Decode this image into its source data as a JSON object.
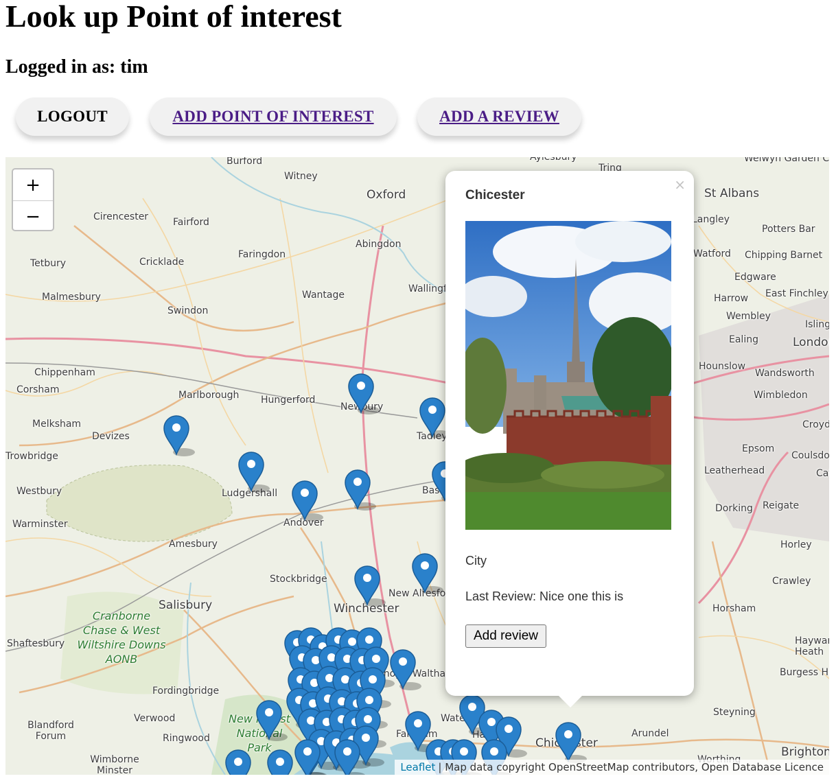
{
  "page": {
    "title": "Look up Point of interest",
    "logged_in": "Logged in as: tim"
  },
  "nav": {
    "logout": "LOGOUT",
    "add_poi": "ADD POINT OF INTEREST",
    "add_review": "ADD A REVIEW"
  },
  "map": {
    "zoom_in": "+",
    "zoom_out": "−",
    "towns": [
      {
        "name": "Burford"
      },
      {
        "name": "Witney"
      },
      {
        "name": "Aylesbury"
      },
      {
        "name": "Tring"
      },
      {
        "name": "Welwyn Garden City"
      },
      {
        "name": "St Albans"
      },
      {
        "name": "Oxford"
      },
      {
        "name": "Cirencester"
      },
      {
        "name": "Fairford"
      },
      {
        "name": "Abingdon"
      },
      {
        "name": "Tetbury"
      },
      {
        "name": "Cricklade"
      },
      {
        "name": "Faringdon"
      },
      {
        "name": "Malmesbury"
      },
      {
        "name": "Wantage"
      },
      {
        "name": "Wallingford"
      },
      {
        "name": "Swindon"
      },
      {
        "name": "Chippenham"
      },
      {
        "name": "Corsham"
      },
      {
        "name": "Marlborough"
      },
      {
        "name": "Hungerford"
      },
      {
        "name": "Newbury"
      },
      {
        "name": "Melksham"
      },
      {
        "name": "Devizes"
      },
      {
        "name": "Tadley"
      },
      {
        "name": "Trowbridge"
      },
      {
        "name": "Westbury"
      },
      {
        "name": "Ludgershall"
      },
      {
        "name": "Andover"
      },
      {
        "name": "Basingstoke"
      },
      {
        "name": "Warminster"
      },
      {
        "name": "Amesbury"
      },
      {
        "name": "Stockbridge"
      },
      {
        "name": "New Alresford"
      },
      {
        "name": "Salisbury"
      },
      {
        "name": "Winchester"
      },
      {
        "name": "Shaftesbury"
      },
      {
        "name": "Bishop's Waltham"
      },
      {
        "name": "Fordingbridge"
      },
      {
        "name": "Verwood"
      },
      {
        "name": "Ringwood"
      },
      {
        "name": "Blandford Forum"
      },
      {
        "name": "Wimborne Minster"
      },
      {
        "name": "Waterlooville"
      },
      {
        "name": "Fareham"
      },
      {
        "name": "Havant"
      },
      {
        "name": "Chichester"
      },
      {
        "name": "Arundel"
      },
      {
        "name": "Worthing"
      },
      {
        "name": "Brighton"
      },
      {
        "name": "Steyning"
      },
      {
        "name": "Horsham"
      },
      {
        "name": "Burgess Hill"
      },
      {
        "name": "Haywards Heath"
      },
      {
        "name": "Crawley"
      },
      {
        "name": "Horley"
      },
      {
        "name": "Dorking"
      },
      {
        "name": "Reigate"
      },
      {
        "name": "Leatherhead"
      },
      {
        "name": "Epsom"
      },
      {
        "name": "Coulsdon"
      },
      {
        "name": "Croydon"
      },
      {
        "name": "Caterham"
      },
      {
        "name": "Wimbledon"
      },
      {
        "name": "Wandsworth"
      },
      {
        "name": "Hounslow"
      },
      {
        "name": "Ealing"
      },
      {
        "name": "London"
      },
      {
        "name": "Islington"
      },
      {
        "name": "Wembley"
      },
      {
        "name": "Harrow"
      },
      {
        "name": "East Finchley"
      },
      {
        "name": "Edgware"
      },
      {
        "name": "Watford"
      },
      {
        "name": "Chipping Barnet"
      },
      {
        "name": "Potters Bar"
      },
      {
        "name": "Langley"
      }
    ],
    "aonb_label": "Cranborne Chase & West Wiltshire Downs AONB",
    "park_label": "New Forest National Park",
    "attribution_leaflet": "Leaflet",
    "attribution_text": "| Map data copyright OpenStreetMap contributors, Open Database Licence"
  },
  "popup": {
    "close": "×",
    "title": "Chicester",
    "type": "City",
    "review": "Last Review: Nice one this is",
    "button": "Add review"
  }
}
